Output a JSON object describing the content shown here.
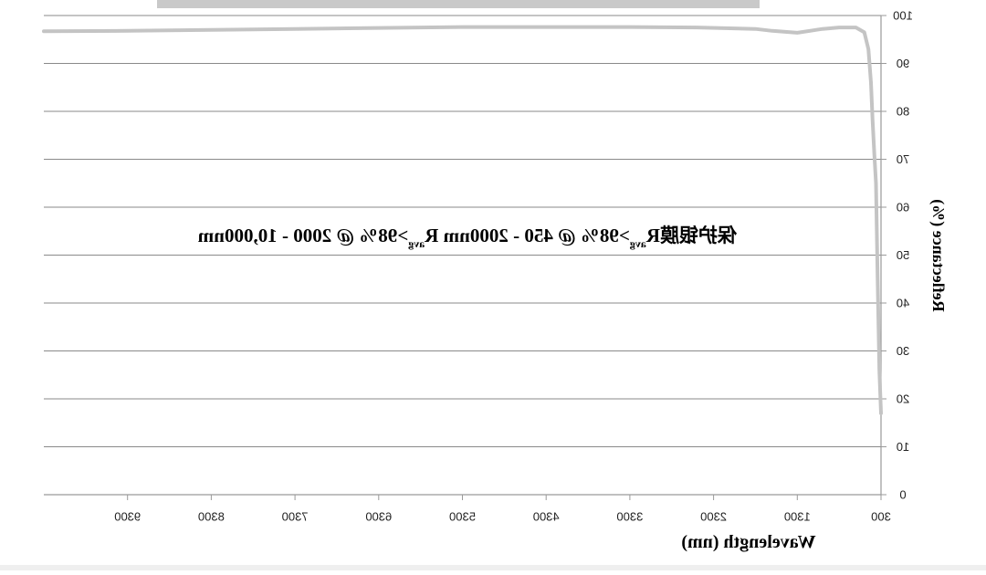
{
  "chart_data": {
    "type": "line",
    "title": "",
    "annotation": {
      "main": "保护银膜R",
      "sub1": "avg",
      "part2": ">98% @ 450 - 2000nm R",
      "sub2": "avg",
      "part3": ">98% @ 2000 - 10,000nm"
    },
    "xlabel": "Wavelength (nm)",
    "ylabel": "Reflectance (%)",
    "xlim": [
      300,
      10300
    ],
    "ylim": [
      0,
      100
    ],
    "x_axis_reversed": true,
    "mirrored": true,
    "grid": true,
    "x_ticks": [
      300,
      1300,
      2300,
      3300,
      4300,
      5300,
      6300,
      7300,
      8300,
      9300
    ],
    "y_ticks": [
      0,
      10,
      20,
      30,
      40,
      50,
      60,
      70,
      80,
      90,
      100
    ],
    "series": [
      {
        "color": "#c4c4c4",
        "x": [
          300,
          320,
          340,
          360,
          380,
          400,
          420,
          450,
          500,
          600,
          800,
          1000,
          1300,
          1600,
          1800,
          2000,
          2500,
          3300,
          4300,
          5300,
          6300,
          7300,
          8300,
          9300,
          10300
        ],
        "y": [
          17,
          26,
          45,
          65,
          71,
          78,
          86,
          93,
          96.5,
          97.5,
          97.5,
          97.2,
          96.4,
          96.8,
          97.2,
          97.3,
          97.5,
          97.6,
          97.6,
          97.6,
          97.4,
          97.2,
          97.0,
          96.8,
          96.7
        ]
      }
    ]
  }
}
